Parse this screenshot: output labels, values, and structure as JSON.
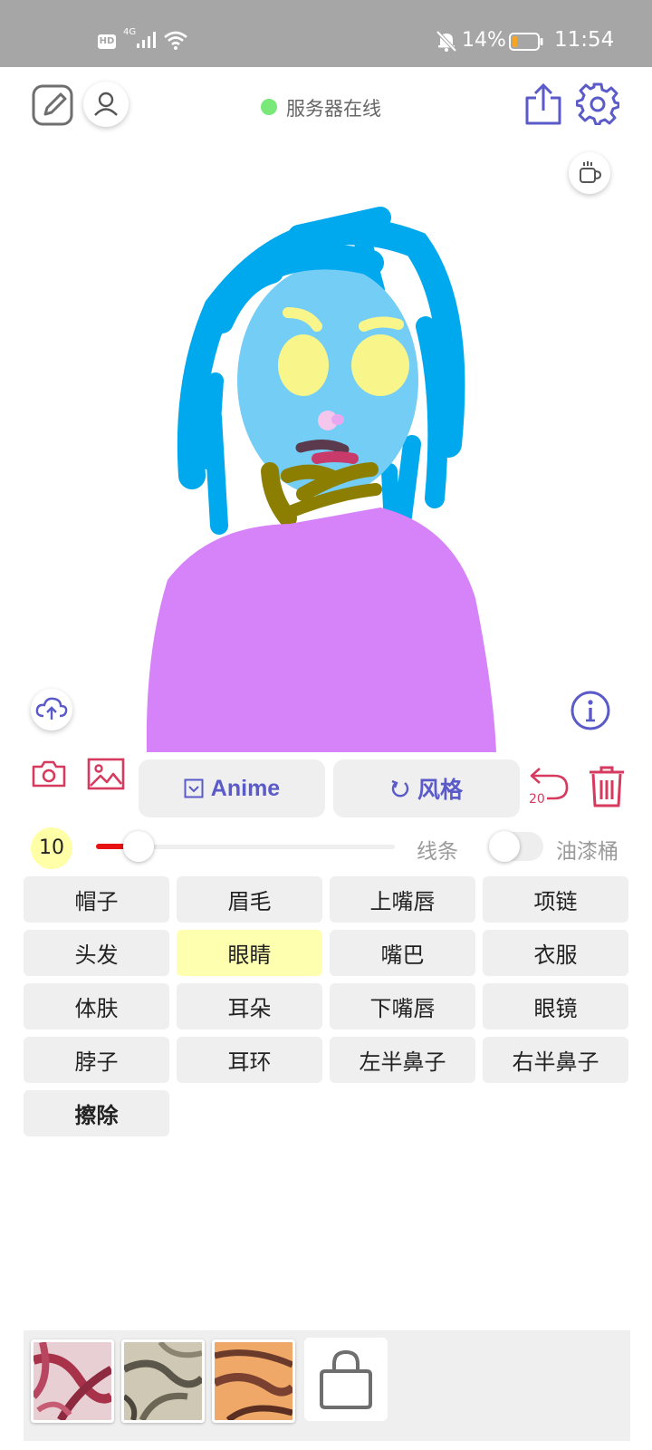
{
  "status_bar": {
    "hd": "HD",
    "network": "4G",
    "battery_percent": "14%",
    "battery_level": 0.14,
    "time": "11:54",
    "icons": [
      "signal-icon",
      "wifi-icon",
      "bell-muted-icon",
      "battery-icon"
    ]
  },
  "header": {
    "server_status": "服务器在线",
    "server_status_color": "#78e878",
    "icons": [
      "edit-icon",
      "user-icon",
      "share-icon",
      "gear-icon",
      "coffee-icon"
    ]
  },
  "canvas": {
    "icons": [
      "cloud-upload-icon",
      "info-icon"
    ]
  },
  "toolbar": {
    "anime_label": "Anime",
    "style_label": "风格",
    "undo_count": "20",
    "icons": [
      "camera-icon",
      "image-icon",
      "checkbox-icon",
      "refresh-icon",
      "undo-icon",
      "trash-icon"
    ],
    "accent_color": "#d63a5e",
    "primary_color": "#5a5ac8"
  },
  "brush": {
    "size": "10",
    "line_label": "线条",
    "bucket_label": "油漆桶",
    "slider_fill_color": "#e81212"
  },
  "parts": [
    {
      "label": "帽子"
    },
    {
      "label": "眉毛"
    },
    {
      "label": "上嘴唇"
    },
    {
      "label": "项链"
    },
    {
      "label": "头发"
    },
    {
      "label": "眼睛",
      "selected": true
    },
    {
      "label": "嘴巴"
    },
    {
      "label": "衣服"
    },
    {
      "label": "体肤"
    },
    {
      "label": "耳朵"
    },
    {
      "label": "下嘴唇"
    },
    {
      "label": "眼镜"
    },
    {
      "label": "脖子"
    },
    {
      "label": "耳环"
    },
    {
      "label": "左半鼻子"
    },
    {
      "label": "右半鼻子"
    },
    {
      "label": "擦除",
      "bold": true
    }
  ],
  "styles": {
    "icons": [
      "shopping-bag-icon"
    ]
  }
}
